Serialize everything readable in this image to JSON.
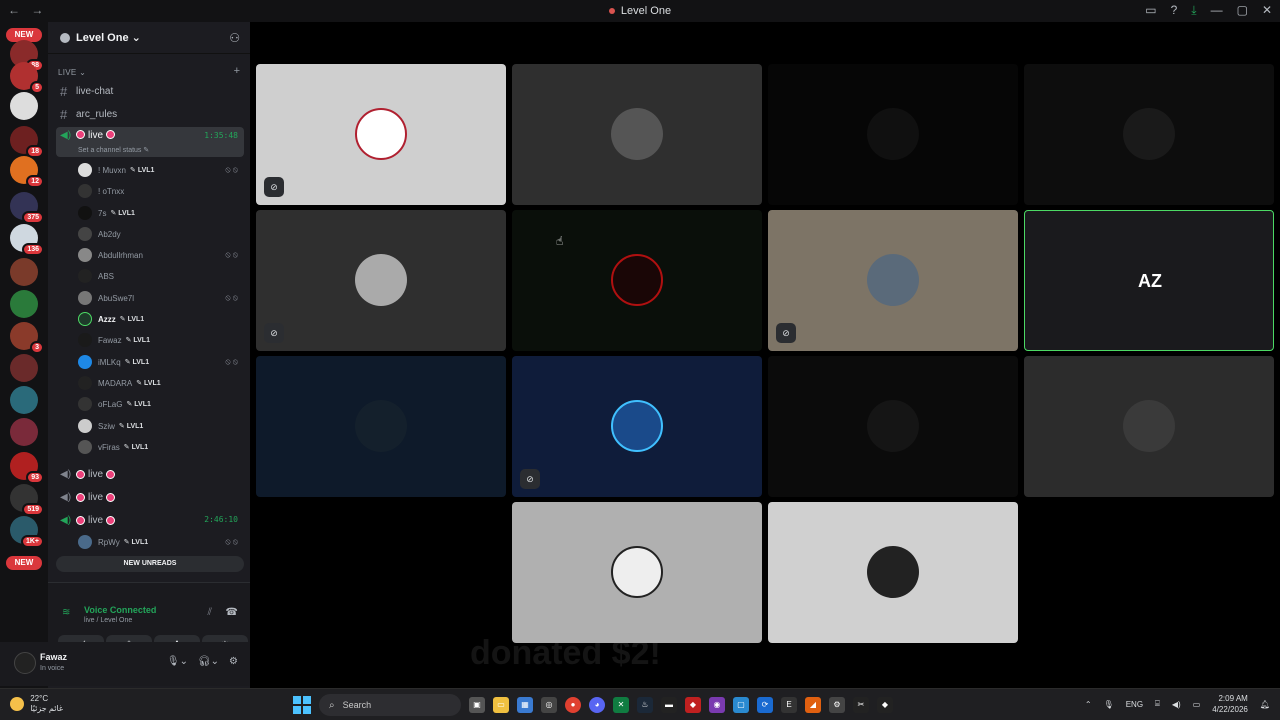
{
  "titlebar": {
    "title": "Level One",
    "back": "←",
    "forward": "→"
  },
  "guilds": {
    "new_top": "NEW",
    "new_bottom": "NEW",
    "badges": [
      "88",
      "5",
      "18",
      "12",
      "375",
      "136",
      "3",
      "93",
      "519",
      "1K+"
    ]
  },
  "server": {
    "name": "Level One ⌄",
    "category": "LIVE ⌄"
  },
  "channels": {
    "live_chat": "live-chat",
    "arc_rules": "arc_rules",
    "live_active": "live",
    "live_active_timer": "1:35:48",
    "set_status": "Set a channel status ✎",
    "live2": "live",
    "live3": "live",
    "live4": "live",
    "live4_timer": "2:46:10"
  },
  "members": [
    {
      "name": "! Muvxn",
      "lvl": "✎ LVL1"
    },
    {
      "name": "! oTnxx",
      "lvl": ""
    },
    {
      "name": "7s",
      "lvl": "✎ LVL1"
    },
    {
      "name": "Ab2dy",
      "lvl": ""
    },
    {
      "name": "Abdullrhman",
      "lvl": ""
    },
    {
      "name": "ABS",
      "lvl": ""
    },
    {
      "name": "AbuSwe7l",
      "lvl": ""
    },
    {
      "name": "Azzz",
      "lvl": "✎ LVL1"
    },
    {
      "name": "Fawaz",
      "lvl": "✎ LVL1"
    },
    {
      "name": "iMLKq",
      "lvl": "✎ LVL1"
    },
    {
      "name": "MADARA",
      "lvl": "✎ LVL1"
    },
    {
      "name": "oFLaG",
      "lvl": "✎ LVL1"
    },
    {
      "name": "Sziw",
      "lvl": "✎ LVL1"
    },
    {
      "name": "vFiras",
      "lvl": "✎ LVL1"
    }
  ],
  "member_live4": {
    "name": "RpWy",
    "lvl": "✎ LVL1"
  },
  "new_unreads": "NEW UNREADS",
  "voice": {
    "status": "Voice Connected",
    "channel": "live / Level One"
  },
  "user": {
    "name": "Fawaz",
    "status": "In voice"
  },
  "stage": {
    "ghost_text": "donated $2!",
    "az_logo": "AZ"
  },
  "taskbar": {
    "weather_temp": "22°C",
    "weather_desc": "غائم جزئيًا",
    "search_placeholder": "Search",
    "lang": "ENG",
    "time": "2:09 AM",
    "date": "4/22/2026"
  },
  "colors": {
    "accent_green": "#23a55a",
    "badge_red": "#da373c",
    "live_pink": "#ec407a"
  }
}
